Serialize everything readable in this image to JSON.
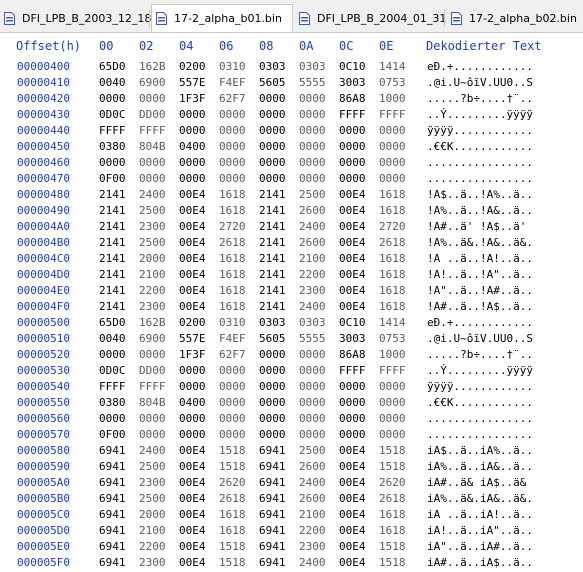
{
  "tabs": [
    {
      "label": "DFI_LPB_B_2003_12_18",
      "active": false
    },
    {
      "label": "17-2_alpha_b01.bin",
      "active": true
    },
    {
      "label": "DFI_LPB_B_2004_01_31",
      "active": false
    },
    {
      "label": "17-2_alpha_b02.bin",
      "active": false
    }
  ],
  "columns": {
    "offset_label": "Offset(h)",
    "hex": [
      "00",
      "02",
      "04",
      "06",
      "08",
      "0A",
      "0C",
      "0E"
    ],
    "text_label": "Dekodierter Text"
  },
  "colors": {
    "accent": "#1e3cc8",
    "text": "#000000",
    "alt_hex": "#5a5a5a"
  },
  "rows": [
    {
      "offset": "00000400",
      "hex": [
        "65D0",
        "162B",
        "0200",
        "0310",
        "0303",
        "0303",
        "0C10",
        "1414"
      ],
      "text": "eÐ.+............"
    },
    {
      "offset": "00000410",
      "hex": [
        "0040",
        "6900",
        "557E",
        "F4EF",
        "5605",
        "5555",
        "3003",
        "0753"
      ],
      "text": ".@i.U~ôïV.UU0..S"
    },
    {
      "offset": "00000420",
      "hex": [
        "0000",
        "0000",
        "1F3F",
        "62F7",
        "0000",
        "0000",
        "86A8",
        "1000"
      ],
      "text": ".....?b÷....†¨.."
    },
    {
      "offset": "00000430",
      "hex": [
        "0D0C",
        "DD00",
        "0000",
        "0000",
        "0000",
        "0000",
        "FFFF",
        "FFFF"
      ],
      "text": "..Ý.........ÿÿÿÿ"
    },
    {
      "offset": "00000440",
      "hex": [
        "FFFF",
        "FFFF",
        "0000",
        "0000",
        "0000",
        "0000",
        "0000",
        "0000"
      ],
      "text": "ÿÿÿÿ............"
    },
    {
      "offset": "00000450",
      "hex": [
        "0380",
        "804B",
        "0400",
        "0000",
        "0000",
        "0000",
        "0000",
        "0000"
      ],
      "text": ".€€K............"
    },
    {
      "offset": "00000460",
      "hex": [
        "0000",
        "0000",
        "0000",
        "0000",
        "0000",
        "0000",
        "0000",
        "0000"
      ],
      "text": "................"
    },
    {
      "offset": "00000470",
      "hex": [
        "0F00",
        "0000",
        "0000",
        "0000",
        "0000",
        "0000",
        "0000",
        "0000"
      ],
      "text": "................"
    },
    {
      "offset": "00000480",
      "hex": [
        "2141",
        "2400",
        "00E4",
        "1618",
        "2141",
        "2500",
        "00E4",
        "1618"
      ],
      "text": "!A$..ä..!A%..ä.."
    },
    {
      "offset": "00000490",
      "hex": [
        "2141",
        "2500",
        "00E4",
        "1618",
        "2141",
        "2600",
        "00E4",
        "1618"
      ],
      "text": "!A%..ä..!A&..ä.."
    },
    {
      "offset": "000004A0",
      "hex": [
        "2141",
        "2300",
        "00E4",
        "2720",
        "2141",
        "2400",
        "00E4",
        "2720"
      ],
      "text": "!A#..ä' !A$..ä' "
    },
    {
      "offset": "000004B0",
      "hex": [
        "2141",
        "2500",
        "00E4",
        "2618",
        "2141",
        "2600",
        "00E4",
        "2618"
      ],
      "text": "!A%..ä&.!A&..ä&."
    },
    {
      "offset": "000004C0",
      "hex": [
        "2141",
        "2000",
        "00E4",
        "1618",
        "2141",
        "2100",
        "00E4",
        "1618"
      ],
      "text": "!A ..ä..!A!..ä.."
    },
    {
      "offset": "000004D0",
      "hex": [
        "2141",
        "2100",
        "00E4",
        "1618",
        "2141",
        "2200",
        "00E4",
        "1618"
      ],
      "text": "!A!..ä..!A\"..ä.."
    },
    {
      "offset": "000004E0",
      "hex": [
        "2141",
        "2200",
        "00E4",
        "1618",
        "2141",
        "2300",
        "00E4",
        "1618"
      ],
      "text": "!A\"..ä..!A#..ä.."
    },
    {
      "offset": "000004F0",
      "hex": [
        "2141",
        "2300",
        "00E4",
        "1618",
        "2141",
        "2400",
        "00E4",
        "1618"
      ],
      "text": "!A#..ä..!A$..ä.."
    },
    {
      "offset": "00000500",
      "hex": [
        "65D0",
        "162B",
        "0200",
        "0310",
        "0303",
        "0303",
        "0C10",
        "1414"
      ],
      "text": "eÐ.+............"
    },
    {
      "offset": "00000510",
      "hex": [
        "0040",
        "6900",
        "557E",
        "F4EF",
        "5605",
        "5555",
        "3003",
        "0753"
      ],
      "text": ".@i.U~ôïV.UU0..S"
    },
    {
      "offset": "00000520",
      "hex": [
        "0000",
        "0000",
        "1F3F",
        "62F7",
        "0000",
        "0000",
        "86A8",
        "1000"
      ],
      "text": ".....?b÷....†¨.."
    },
    {
      "offset": "00000530",
      "hex": [
        "0D0C",
        "DD00",
        "0000",
        "0000",
        "0000",
        "0000",
        "FFFF",
        "FFFF"
      ],
      "text": "..Ý.........ÿÿÿÿ"
    },
    {
      "offset": "00000540",
      "hex": [
        "FFFF",
        "FFFF",
        "0000",
        "0000",
        "0000",
        "0000",
        "0000",
        "0000"
      ],
      "text": "ÿÿÿÿ............"
    },
    {
      "offset": "00000550",
      "hex": [
        "0380",
        "804B",
        "0400",
        "0000",
        "0000",
        "0000",
        "0000",
        "0000"
      ],
      "text": ".€€K............"
    },
    {
      "offset": "00000560",
      "hex": [
        "0000",
        "0000",
        "0000",
        "0000",
        "0000",
        "0000",
        "0000",
        "0000"
      ],
      "text": "................"
    },
    {
      "offset": "00000570",
      "hex": [
        "0F00",
        "0000",
        "0000",
        "0000",
        "0000",
        "0000",
        "0000",
        "0000"
      ],
      "text": "................"
    },
    {
      "offset": "00000580",
      "hex": [
        "6941",
        "2400",
        "00E4",
        "1518",
        "6941",
        "2500",
        "00E4",
        "1518"
      ],
      "text": "iA$..ä..iA%..ä.."
    },
    {
      "offset": "00000590",
      "hex": [
        "6941",
        "2500",
        "00E4",
        "1518",
        "6941",
        "2600",
        "00E4",
        "1518"
      ],
      "text": "iA%..ä..iA&..ä.."
    },
    {
      "offset": "000005A0",
      "hex": [
        "6941",
        "2300",
        "00E4",
        "2620",
        "6941",
        "2400",
        "00E4",
        "2620"
      ],
      "text": "iA#..ä& iA$..ä& "
    },
    {
      "offset": "000005B0",
      "hex": [
        "6941",
        "2500",
        "00E4",
        "2618",
        "6941",
        "2600",
        "00E4",
        "2618"
      ],
      "text": "iA%..ä&.iA&..ä&."
    },
    {
      "offset": "000005C0",
      "hex": [
        "6941",
        "2000",
        "00E4",
        "1618",
        "6941",
        "2100",
        "00E4",
        "1618"
      ],
      "text": "iA ..ä..iA!..ä.."
    },
    {
      "offset": "000005D0",
      "hex": [
        "6941",
        "2100",
        "00E4",
        "1618",
        "6941",
        "2200",
        "00E4",
        "1618"
      ],
      "text": "iA!..ä..iA\"..ä.."
    },
    {
      "offset": "000005E0",
      "hex": [
        "6941",
        "2200",
        "00E4",
        "1518",
        "6941",
        "2300",
        "00E4",
        "1518"
      ],
      "text": "iA\"..ä..iA#..ä.."
    },
    {
      "offset": "000005F0",
      "hex": [
        "6941",
        "2300",
        "00E4",
        "1518",
        "6941",
        "2400",
        "00E4",
        "1518"
      ],
      "text": "iA#..ä..iA$..ä.."
    }
  ]
}
